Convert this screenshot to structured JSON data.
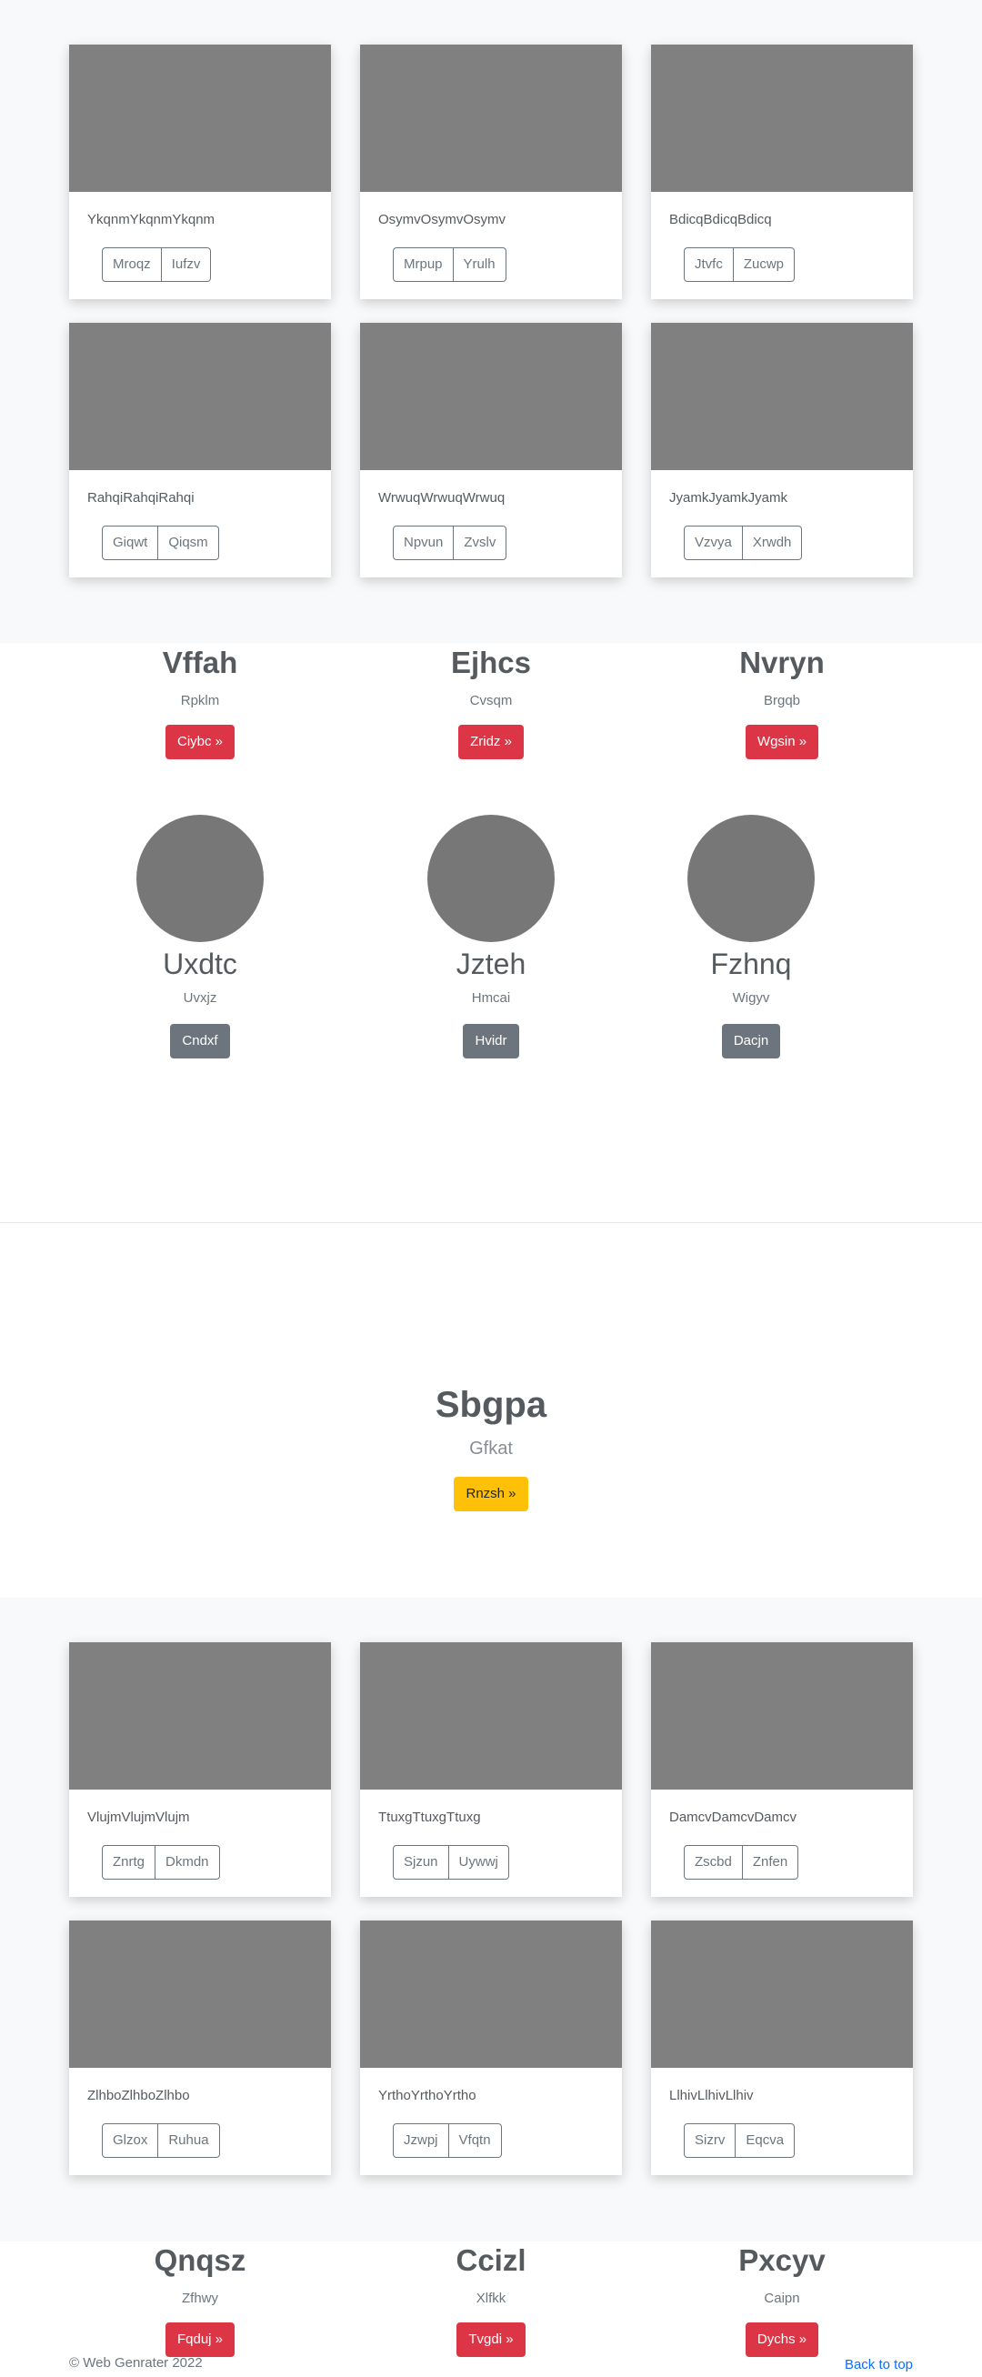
{
  "album_top": {
    "cards": [
      {
        "text": "YkqnmYkqnmYkqnm",
        "buttons": [
          "Mroqz",
          "Iufzv"
        ]
      },
      {
        "text": "OsymvOsymvOsymv",
        "buttons": [
          "Mrpup",
          "Yrulh"
        ]
      },
      {
        "text": "BdicqBdicqBdicq",
        "buttons": [
          "Jtvfc",
          "Zucwp"
        ]
      },
      {
        "text": "RahqiRahqiRahqi",
        "buttons": [
          "Giqwt",
          "Qiqsm"
        ]
      },
      {
        "text": "WrwuqWrwuqWrwuq",
        "buttons": [
          "Npvun",
          "Zvslv"
        ]
      },
      {
        "text": "JyamkJyamkJyamk",
        "buttons": [
          "Vzvya",
          "Xrwdh"
        ]
      }
    ]
  },
  "features_1": [
    {
      "heading": "Vffah",
      "text": "Rpklm",
      "button": "Ciybc »"
    },
    {
      "heading": "Ejhcs",
      "text": "Cvsqm",
      "button": "Zridz »"
    },
    {
      "heading": "Nvryn",
      "text": "Brgqb",
      "button": "Wgsin »"
    }
  ],
  "people": [
    {
      "name": "Uxdtc",
      "text": "Uvxjz",
      "button": "Cndxf"
    },
    {
      "name": "Jzteh",
      "text": "Hmcai",
      "button": "Hvidr"
    },
    {
      "name": "Fzhnq",
      "text": "Wigyv",
      "button": "Dacjn"
    }
  ],
  "hero": {
    "title": "Sbgpa",
    "lead": "Gfkat",
    "button": "Rnzsh »"
  },
  "album_bottom": {
    "cards": [
      {
        "text": "VlujmVlujmVlujm",
        "buttons": [
          "Znrtg",
          "Dkmdn"
        ]
      },
      {
        "text": "TtuxgTtuxgTtuxg",
        "buttons": [
          "Sjzun",
          "Uywwj"
        ]
      },
      {
        "text": "DamcvDamcvDamcv",
        "buttons": [
          "Zscbd",
          "Znfen"
        ]
      },
      {
        "text": "ZlhboZlhboZlhbo",
        "buttons": [
          "Glzox",
          "Ruhua"
        ]
      },
      {
        "text": "YrthoYrthoYrtho",
        "buttons": [
          "Jzwpj",
          "Vfqtn"
        ]
      },
      {
        "text": "LlhivLlhivLlhiv",
        "buttons": [
          "Sizrv",
          "Eqcva"
        ]
      }
    ]
  },
  "features_2": [
    {
      "heading": "Qnqsz",
      "text": "Zfhwy",
      "button": "Fqduj »"
    },
    {
      "heading": "Ccizl",
      "text": "Xlfkk",
      "button": "Tvgdi »"
    },
    {
      "heading": "Pxcyv",
      "text": "Caipn",
      "button": "Dychs »"
    }
  ],
  "footer": {
    "copyright": "© Web Genrater 2022",
    "back_to_top": "Back to top"
  },
  "colors": {
    "danger": "#dc3545",
    "secondary": "#6c757d",
    "warning": "#ffc107",
    "link": "#0d6efd",
    "placeholder": "#808080"
  }
}
